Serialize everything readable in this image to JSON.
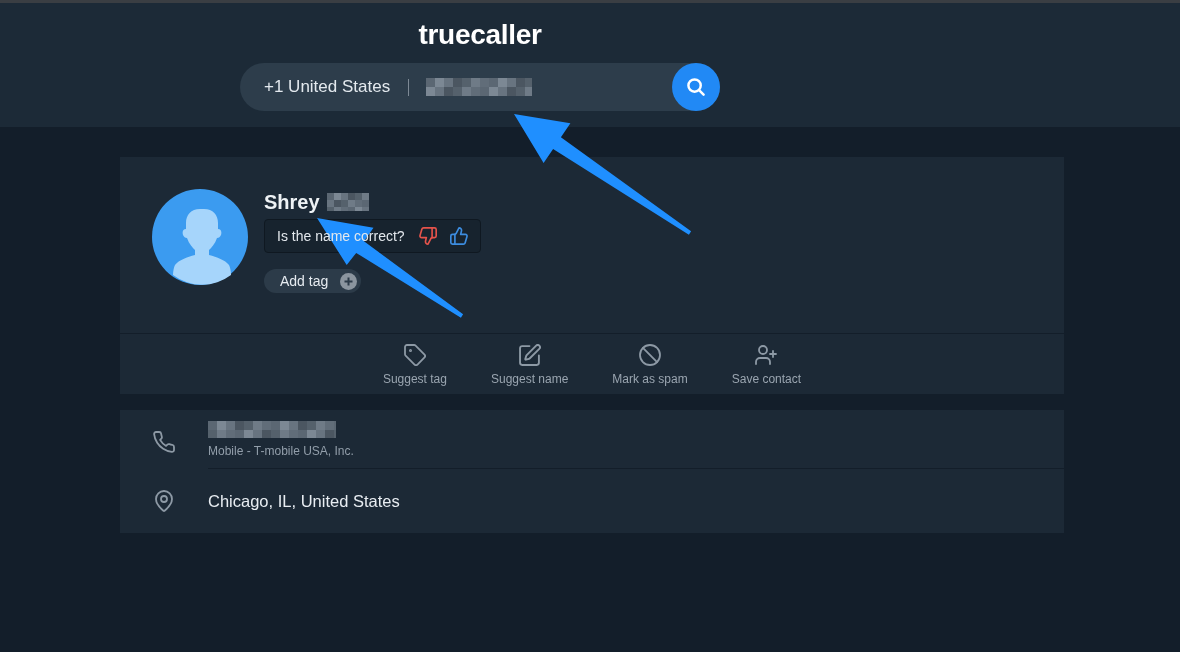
{
  "header": {
    "logo": "truecaller",
    "search": {
      "country": "+1 United States",
      "number_redacted": true
    }
  },
  "profile": {
    "name": "Shrey",
    "name_redacted": true,
    "question": "Is the name correct?",
    "add_tag": "Add tag"
  },
  "actions": [
    {
      "kind": "tag",
      "label": "Suggest tag"
    },
    {
      "kind": "name",
      "label": "Suggest name"
    },
    {
      "kind": "spam",
      "label": "Mark as spam"
    },
    {
      "kind": "contact",
      "label": "Save contact"
    }
  ],
  "details": [
    {
      "kind": "phone",
      "number_redacted": true,
      "subtitle": "Mobile - T-mobile USA, Inc."
    },
    {
      "kind": "location",
      "text": "Chicago, IL, United States"
    }
  ]
}
